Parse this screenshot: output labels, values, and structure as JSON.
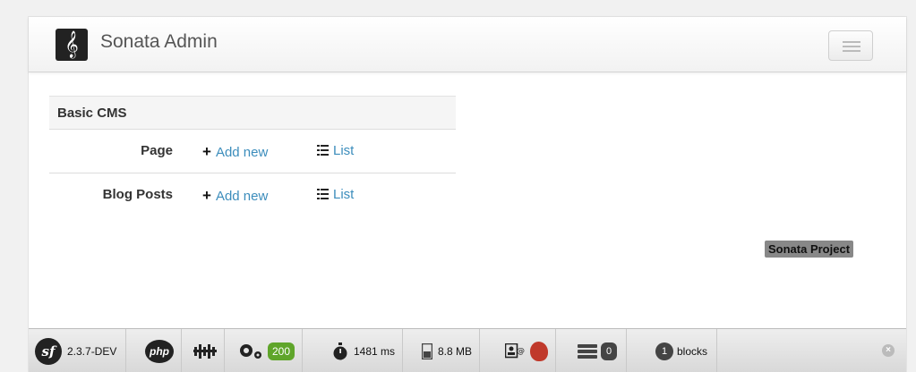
{
  "navbar": {
    "brand": "Sonata Admin",
    "logo_glyph": "𝄞"
  },
  "dashboard": {
    "group_title": "Basic CMS",
    "rows": [
      {
        "label": "Page",
        "add_label": "Add new",
        "list_label": "List"
      },
      {
        "label": "Blog Posts",
        "add_label": "Add new",
        "list_label": "List"
      }
    ]
  },
  "badge": "Sonata Project",
  "toolbar": {
    "sf_logo": "sf",
    "version": "2.3.7-DEV",
    "php_logo": "php",
    "status_code": "200",
    "time": "1481 ms",
    "memory": "8.8 MB",
    "db_count": "0",
    "blocks_count": "1",
    "blocks_label": "blocks",
    "status_color": "#5fa52a",
    "mail_color": "#c0392b"
  }
}
